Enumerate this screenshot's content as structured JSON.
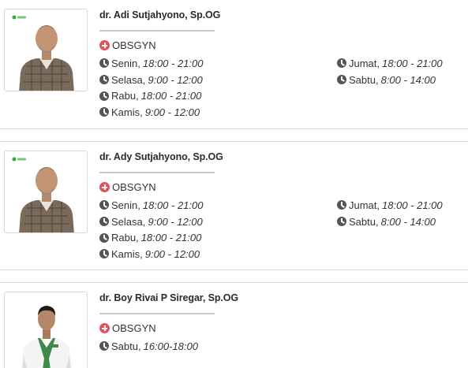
{
  "doctors": [
    {
      "name": "dr. Adi Sutjahyono, Sp.OG",
      "specialty": "OBSGYN",
      "schedule_left": [
        {
          "day": "Senin,",
          "time": "18:00 - 21:00"
        },
        {
          "day": "Selasa,",
          "time": "9:00 - 12:00"
        },
        {
          "day": "Rabu,",
          "time": "18:00 - 21:00"
        },
        {
          "day": "Kamis,",
          "time": "9:00 - 12:00"
        }
      ],
      "schedule_right": [
        {
          "day": "Jumat,",
          "time": "18:00 - 21:00"
        },
        {
          "day": "Sabtu,",
          "time": "8:00 - 14:00"
        }
      ]
    },
    {
      "name": "dr. Ady Sutjahyono, Sp.OG",
      "specialty": "OBSGYN",
      "schedule_left": [
        {
          "day": "Senin,",
          "time": "18:00 - 21:00"
        },
        {
          "day": "Selasa,",
          "time": "9:00 - 12:00"
        },
        {
          "day": "Rabu,",
          "time": "18:00 - 21:00"
        },
        {
          "day": "Kamis,",
          "time": "9:00 - 12:00"
        }
      ],
      "schedule_right": [
        {
          "day": "Jumat,",
          "time": "18:00 - 21:00"
        },
        {
          "day": "Sabtu,",
          "time": "8:00 - 14:00"
        }
      ]
    },
    {
      "name": "dr. Boy Rivai P Siregar, Sp.OG",
      "specialty": "OBSGYN",
      "schedule_left": [
        {
          "day": "Sabtu,",
          "time": "16:00-18:00"
        }
      ],
      "schedule_right": []
    }
  ],
  "colors": {
    "specialty_icon": "#e0545b",
    "clock_icon": "#555555",
    "divider": "#dcdcdc",
    "logo_green": "#3aaa35"
  },
  "icons": {
    "specialty": "plus-circle-icon",
    "schedule": "clock-icon"
  }
}
